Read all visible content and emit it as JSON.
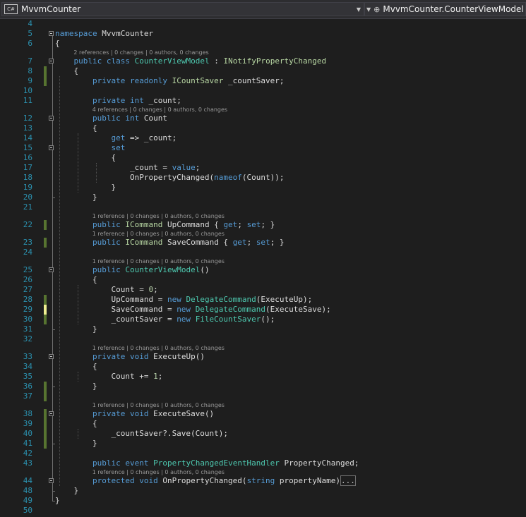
{
  "navbar": {
    "project_badge": "C#",
    "project": "MvvmCounter",
    "member": "MvvmCounter.CounterViewModel"
  },
  "lines": [
    {
      "n": "4",
      "lens": "",
      "tokens": []
    },
    {
      "n": "5",
      "lens": "",
      "tokens": [
        {
          "t": "namespace",
          "c": "k"
        },
        {
          "t": " MvvmCounter"
        }
      ]
    },
    {
      "n": "6",
      "lens": "",
      "tokens": [
        {
          "t": "{"
        }
      ]
    },
    {
      "n": "7",
      "lens": "2 references | 0 changes | 0 authors, 0 changes",
      "tokens": [
        {
          "t": "    "
        },
        {
          "t": "public",
          "c": "k"
        },
        {
          "t": " "
        },
        {
          "t": "class",
          "c": "k"
        },
        {
          "t": " "
        },
        {
          "t": "CounterViewModel",
          "c": "t"
        },
        {
          "t": " : "
        },
        {
          "t": "INotifyPropertyChanged",
          "c": "i"
        }
      ]
    },
    {
      "n": "8",
      "lens": "",
      "tokens": [
        {
          "t": "    {"
        }
      ]
    },
    {
      "n": "9",
      "lens": "",
      "tokens": [
        {
          "t": "        "
        },
        {
          "t": "private",
          "c": "k"
        },
        {
          "t": " "
        },
        {
          "t": "readonly",
          "c": "k"
        },
        {
          "t": " "
        },
        {
          "t": "ICountSaver",
          "c": "i"
        },
        {
          "t": " _countSaver;"
        }
      ]
    },
    {
      "n": "10",
      "lens": "",
      "tokens": []
    },
    {
      "n": "11",
      "lens": "",
      "tokens": [
        {
          "t": "        "
        },
        {
          "t": "private",
          "c": "k"
        },
        {
          "t": " "
        },
        {
          "t": "int",
          "c": "k"
        },
        {
          "t": " _count;"
        }
      ]
    },
    {
      "n": "12",
      "lens": "4 references | 0 changes | 0 authors, 0 changes",
      "tokens": [
        {
          "t": "        "
        },
        {
          "t": "public",
          "c": "k"
        },
        {
          "t": " "
        },
        {
          "t": "int",
          "c": "k"
        },
        {
          "t": " Count"
        }
      ]
    },
    {
      "n": "13",
      "lens": "",
      "tokens": [
        {
          "t": "        {"
        }
      ]
    },
    {
      "n": "14",
      "lens": "",
      "tokens": [
        {
          "t": "            "
        },
        {
          "t": "get",
          "c": "k"
        },
        {
          "t": " => _count;"
        }
      ]
    },
    {
      "n": "15",
      "lens": "",
      "tokens": [
        {
          "t": "            "
        },
        {
          "t": "set",
          "c": "k"
        }
      ]
    },
    {
      "n": "16",
      "lens": "",
      "tokens": [
        {
          "t": "            {"
        }
      ]
    },
    {
      "n": "17",
      "lens": "",
      "tokens": [
        {
          "t": "                _count = "
        },
        {
          "t": "value",
          "c": "k"
        },
        {
          "t": ";"
        }
      ]
    },
    {
      "n": "18",
      "lens": "",
      "tokens": [
        {
          "t": "                OnPropertyChanged("
        },
        {
          "t": "nameof",
          "c": "k"
        },
        {
          "t": "(Count));"
        }
      ]
    },
    {
      "n": "19",
      "lens": "",
      "tokens": [
        {
          "t": "            }"
        }
      ]
    },
    {
      "n": "20",
      "lens": "",
      "tokens": [
        {
          "t": "        }"
        }
      ]
    },
    {
      "n": "21",
      "lens": "",
      "tokens": []
    },
    {
      "n": "22",
      "lens": "1 reference | 0 changes | 0 authors, 0 changes",
      "tokens": [
        {
          "t": "        "
        },
        {
          "t": "public",
          "c": "k"
        },
        {
          "t": " "
        },
        {
          "t": "ICommand",
          "c": "i"
        },
        {
          "t": " UpCommand { "
        },
        {
          "t": "get",
          "c": "k"
        },
        {
          "t": "; "
        },
        {
          "t": "set",
          "c": "k"
        },
        {
          "t": "; }"
        }
      ]
    },
    {
      "n": "23",
      "lens": "1 reference | 0 changes | 0 authors, 0 changes",
      "tokens": [
        {
          "t": "        "
        },
        {
          "t": "public",
          "c": "k"
        },
        {
          "t": " "
        },
        {
          "t": "ICommand",
          "c": "i"
        },
        {
          "t": " SaveCommand { "
        },
        {
          "t": "get",
          "c": "k"
        },
        {
          "t": "; "
        },
        {
          "t": "set",
          "c": "k"
        },
        {
          "t": "; }"
        }
      ]
    },
    {
      "n": "24",
      "lens": "",
      "tokens": []
    },
    {
      "n": "25",
      "lens": "1 reference | 0 changes | 0 authors, 0 changes",
      "tokens": [
        {
          "t": "        "
        },
        {
          "t": "public",
          "c": "k"
        },
        {
          "t": " "
        },
        {
          "t": "CounterViewModel",
          "c": "t"
        },
        {
          "t": "()"
        }
      ]
    },
    {
      "n": "26",
      "lens": "",
      "tokens": [
        {
          "t": "        {"
        }
      ]
    },
    {
      "n": "27",
      "lens": "",
      "tokens": [
        {
          "t": "            Count = "
        },
        {
          "t": "0",
          "c": "n"
        },
        {
          "t": ";"
        }
      ]
    },
    {
      "n": "28",
      "lens": "",
      "tokens": [
        {
          "t": "            UpCommand = "
        },
        {
          "t": "new",
          "c": "k"
        },
        {
          "t": " "
        },
        {
          "t": "DelegateCommand",
          "c": "t"
        },
        {
          "t": "(ExecuteUp);"
        }
      ]
    },
    {
      "n": "29",
      "lens": "",
      "tokens": [
        {
          "t": "            SaveCommand = "
        },
        {
          "t": "new",
          "c": "k"
        },
        {
          "t": " "
        },
        {
          "t": "DelegateCommand",
          "c": "t"
        },
        {
          "t": "(ExecuteSave);"
        }
      ]
    },
    {
      "n": "30",
      "lens": "",
      "tokens": [
        {
          "t": "            _countSaver = "
        },
        {
          "t": "new",
          "c": "k"
        },
        {
          "t": " "
        },
        {
          "t": "FileCountSaver",
          "c": "t"
        },
        {
          "t": "();"
        }
      ]
    },
    {
      "n": "31",
      "lens": "",
      "tokens": [
        {
          "t": "        }"
        }
      ]
    },
    {
      "n": "32",
      "lens": "",
      "tokens": []
    },
    {
      "n": "33",
      "lens": "1 reference | 0 changes | 0 authors, 0 changes",
      "tokens": [
        {
          "t": "        "
        },
        {
          "t": "private",
          "c": "k"
        },
        {
          "t": " "
        },
        {
          "t": "void",
          "c": "k"
        },
        {
          "t": " ExecuteUp()"
        }
      ]
    },
    {
      "n": "34",
      "lens": "",
      "tokens": [
        {
          "t": "        {"
        }
      ]
    },
    {
      "n": "35",
      "lens": "",
      "tokens": [
        {
          "t": "            Count += "
        },
        {
          "t": "1",
          "c": "n"
        },
        {
          "t": ";"
        }
      ]
    },
    {
      "n": "36",
      "lens": "",
      "tokens": [
        {
          "t": "        }"
        }
      ]
    },
    {
      "n": "37",
      "lens": "",
      "tokens": []
    },
    {
      "n": "38",
      "lens": "1 reference | 0 changes | 0 authors, 0 changes",
      "tokens": [
        {
          "t": "        "
        },
        {
          "t": "private",
          "c": "k"
        },
        {
          "t": " "
        },
        {
          "t": "void",
          "c": "k"
        },
        {
          "t": " ExecuteSave()"
        }
      ]
    },
    {
      "n": "39",
      "lens": "",
      "tokens": [
        {
          "t": "        {"
        }
      ]
    },
    {
      "n": "40",
      "lens": "",
      "tokens": [
        {
          "t": "            _countSaver?.Save(Count);"
        }
      ]
    },
    {
      "n": "41",
      "lens": "",
      "tokens": [
        {
          "t": "        }"
        }
      ]
    },
    {
      "n": "42",
      "lens": "",
      "tokens": []
    },
    {
      "n": "43",
      "lens": "",
      "tokens": [
        {
          "t": "        "
        },
        {
          "t": "public",
          "c": "k"
        },
        {
          "t": " "
        },
        {
          "t": "event",
          "c": "k"
        },
        {
          "t": " "
        },
        {
          "t": "PropertyChangedEventHandler",
          "c": "t"
        },
        {
          "t": " PropertyChanged;"
        }
      ]
    },
    {
      "n": "44",
      "lens": "1 reference | 0 changes | 0 authors, 0 changes",
      "tokens": [
        {
          "t": "        "
        },
        {
          "t": "protected",
          "c": "k"
        },
        {
          "t": " "
        },
        {
          "t": "void",
          "c": "k"
        },
        {
          "t": " OnPropertyChanged("
        },
        {
          "t": "string",
          "c": "k"
        },
        {
          "t": " propertyName)"
        },
        {
          "t": "...",
          "c": "ell"
        }
      ]
    },
    {
      "n": "48",
      "lens": "",
      "tokens": [
        {
          "t": "    }"
        }
      ]
    },
    {
      "n": "49",
      "lens": "",
      "tokens": [
        {
          "t": "}"
        }
      ]
    },
    {
      "n": "50",
      "lens": "",
      "tokens": []
    }
  ],
  "colors": {
    "background": "#1e1e1e",
    "keyword": "#569cd6",
    "type": "#4ec9b0",
    "interface": "#b8d7a3",
    "number": "#b5cea8",
    "linenumber": "#2b91af",
    "saved_change": "#577430",
    "unsaved_change": "#efef91"
  }
}
